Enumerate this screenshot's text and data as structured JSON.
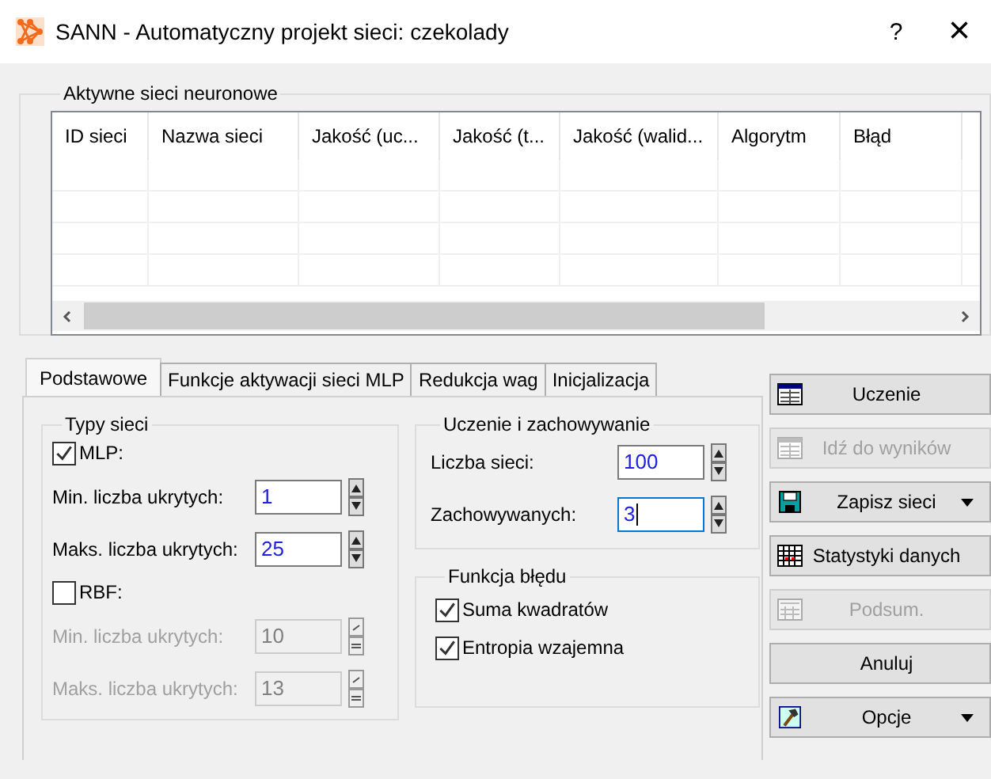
{
  "window": {
    "title": "SANN - Automatyczny projekt sieci: czekolady",
    "help": "?",
    "close": "×"
  },
  "networks_panel": {
    "title": "Aktywne sieci neuronowe",
    "columns": [
      "ID sieci",
      "Nazwa sieci",
      "Jakość (uc...",
      "Jakość (t...",
      "Jakość (walid...",
      "Algorytm",
      "Błąd"
    ]
  },
  "tabs": [
    {
      "label": "Podstawowe",
      "selected": true
    },
    {
      "label": "Funkcje aktywacji sieci MLP",
      "selected": false
    },
    {
      "label": "Redukcja wag",
      "selected": false
    },
    {
      "label": "Inicjalizacja",
      "selected": false
    }
  ],
  "network_types": {
    "title": "Typy sieci",
    "groups": [
      {
        "label": "MLP:",
        "checked": true,
        "fields": [
          {
            "label": "Min. liczba ukrytych:",
            "value": "1"
          },
          {
            "label": "Maks. liczba ukrytych:",
            "value": "25"
          }
        ]
      },
      {
        "label": "RBF:",
        "checked": false,
        "fields": [
          {
            "label": "Min. liczba ukrytych:",
            "value": "10"
          },
          {
            "label": "Maks. liczba ukrytych:",
            "value": "13"
          }
        ]
      }
    ]
  },
  "training": {
    "title": "Uczenie i zachowywanie",
    "fields": [
      {
        "label": "Liczba sieci:",
        "value": "100",
        "focused": false
      },
      {
        "label": "Zachowywanych:",
        "value": "3",
        "focused": true
      }
    ]
  },
  "error_function": {
    "title": "Funkcja błędu",
    "options": [
      {
        "label": "Suma kwadratów",
        "checked": true
      },
      {
        "label": "Entropia wzajemna",
        "checked": true
      }
    ]
  },
  "actions": [
    {
      "label": "Uczenie",
      "kind": "table",
      "disabled": false,
      "dropdown": false
    },
    {
      "label": "Idź do wyników",
      "kind": "table",
      "disabled": true,
      "dropdown": false
    },
    {
      "label": "Zapisz sieci",
      "kind": "disk",
      "disabled": false,
      "dropdown": true
    },
    {
      "label": "Statystyki danych",
      "kind": "grid",
      "disabled": false,
      "dropdown": false
    },
    {
      "label": "Podsum.",
      "kind": "summary",
      "disabled": true,
      "dropdown": false
    },
    {
      "label": "Anuluj",
      "disabled": false,
      "dropdown": false
    },
    {
      "label": "Opcje",
      "kind": "hammer",
      "disabled": false,
      "dropdown": true
    }
  ]
}
